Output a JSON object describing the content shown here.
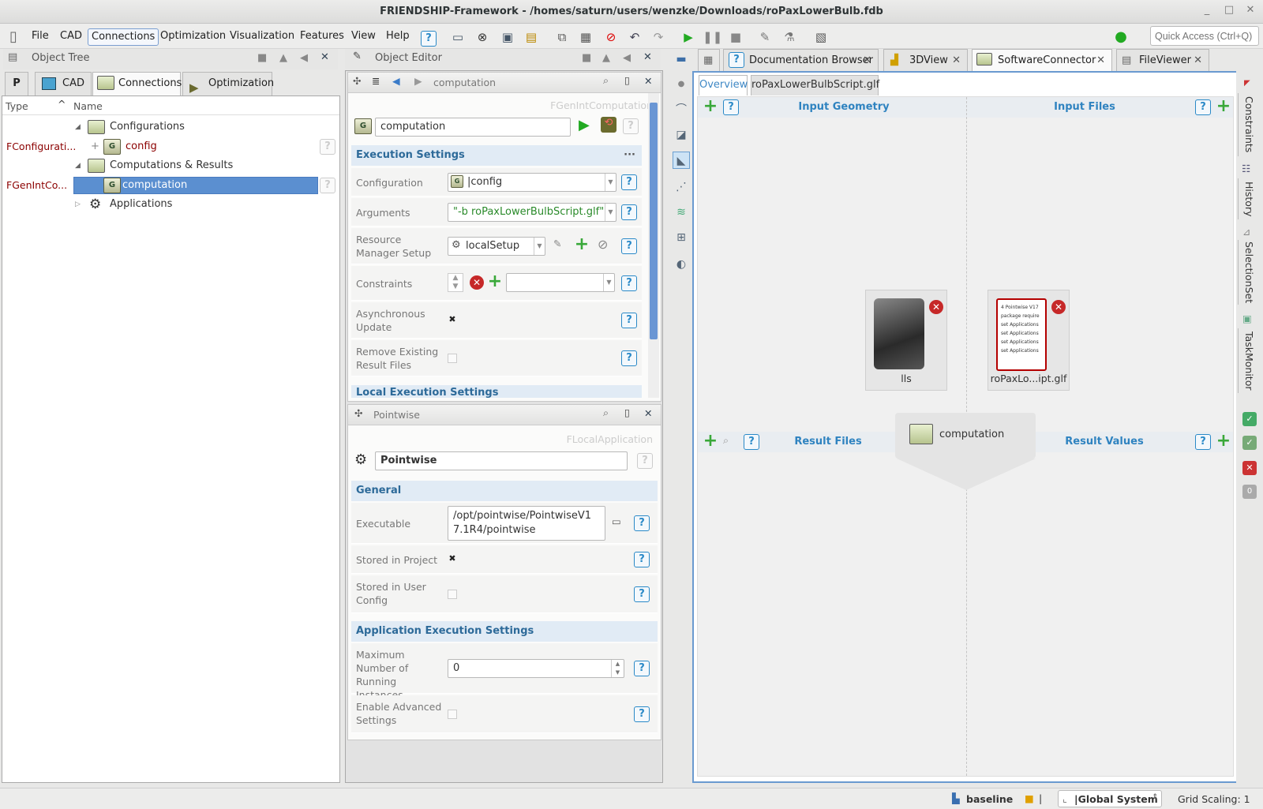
{
  "window": {
    "title": "FRIENDSHIP-Framework - /homes/saturn/users/wenzke/Downloads/roPaxLowerBulb.fdb"
  },
  "menu": {
    "items": [
      "File",
      "CAD",
      "Connections",
      "Optimization",
      "Visualization",
      "Features",
      "View",
      "Help"
    ],
    "quick_access_placeholder": "Quick Access (Ctrl+Q)"
  },
  "object_tree": {
    "title": "Object Tree",
    "tabs": [
      "P",
      "CAD",
      "Connections",
      "Optimization"
    ],
    "col_type": "Type",
    "col_name": "Name",
    "rows": [
      {
        "type": "",
        "name": "Configurations"
      },
      {
        "type": "FConfigurati...",
        "name": "config"
      },
      {
        "type": "",
        "name": "Computations & Results"
      },
      {
        "type": "FGenIntCo...",
        "name": "computation"
      },
      {
        "type": "",
        "name": "Applications"
      }
    ]
  },
  "object_editor": {
    "title": "Object Editor",
    "header": "computation",
    "class_name": "FGenIntComputation",
    "name_value": "computation",
    "execution_settings": "Execution Settings",
    "configuration_label": "Configuration",
    "configuration_value": "|config",
    "arguments_label": "Arguments",
    "arguments_value": "\"-b roPaxLowerBulbScript.glf\"",
    "rm_label": "Resource Manager Setup",
    "rm_value": "localSetup",
    "constraints_label": "Constraints",
    "async_label": "Asynchronous Update",
    "remove_label": "Remove Existing Result Files",
    "local_exec": "Local Execution Settings"
  },
  "pointwise": {
    "header": "Pointwise",
    "class_name": "FLocalApplication",
    "name_value": "Pointwise",
    "general": "General",
    "executable_label": "Executable",
    "executable_value": "/opt/pointwise/PointwiseV17.1R4/pointwise",
    "stored_project_label": "Stored in Project",
    "stored_user_label": "Stored in User Config",
    "app_exec": "Application Execution Settings",
    "max_label": "Maximum Number of Running Instances",
    "max_value": "0",
    "adv_label": "Enable Advanced Settings"
  },
  "right": {
    "tabs": [
      "Documentation Browser",
      "3DView",
      "SoftwareConnector",
      "FileViewer"
    ],
    "subtabs": [
      "Overview",
      "roPaxLowerBulbScript.glf"
    ],
    "input_geometry": "Input Geometry",
    "input_files": "Input Files",
    "result_files": "Result Files",
    "result_values": "Result Values",
    "node_lls": "lls",
    "node_file": "roPaxLo...ipt.glf",
    "computation": "computation",
    "doc_preview": [
      "4 Pointwise V17",
      "package require",
      "set Applications",
      "set Applications",
      "set Applications",
      "set Applications"
    ]
  },
  "side_tabs": [
    "Constraints",
    "History",
    "SelectionSet",
    "TaskMonitor"
  ],
  "status": {
    "baseline": "baseline",
    "system": "|Global System",
    "grid": "Grid Scaling: 1",
    "mid": "|"
  }
}
